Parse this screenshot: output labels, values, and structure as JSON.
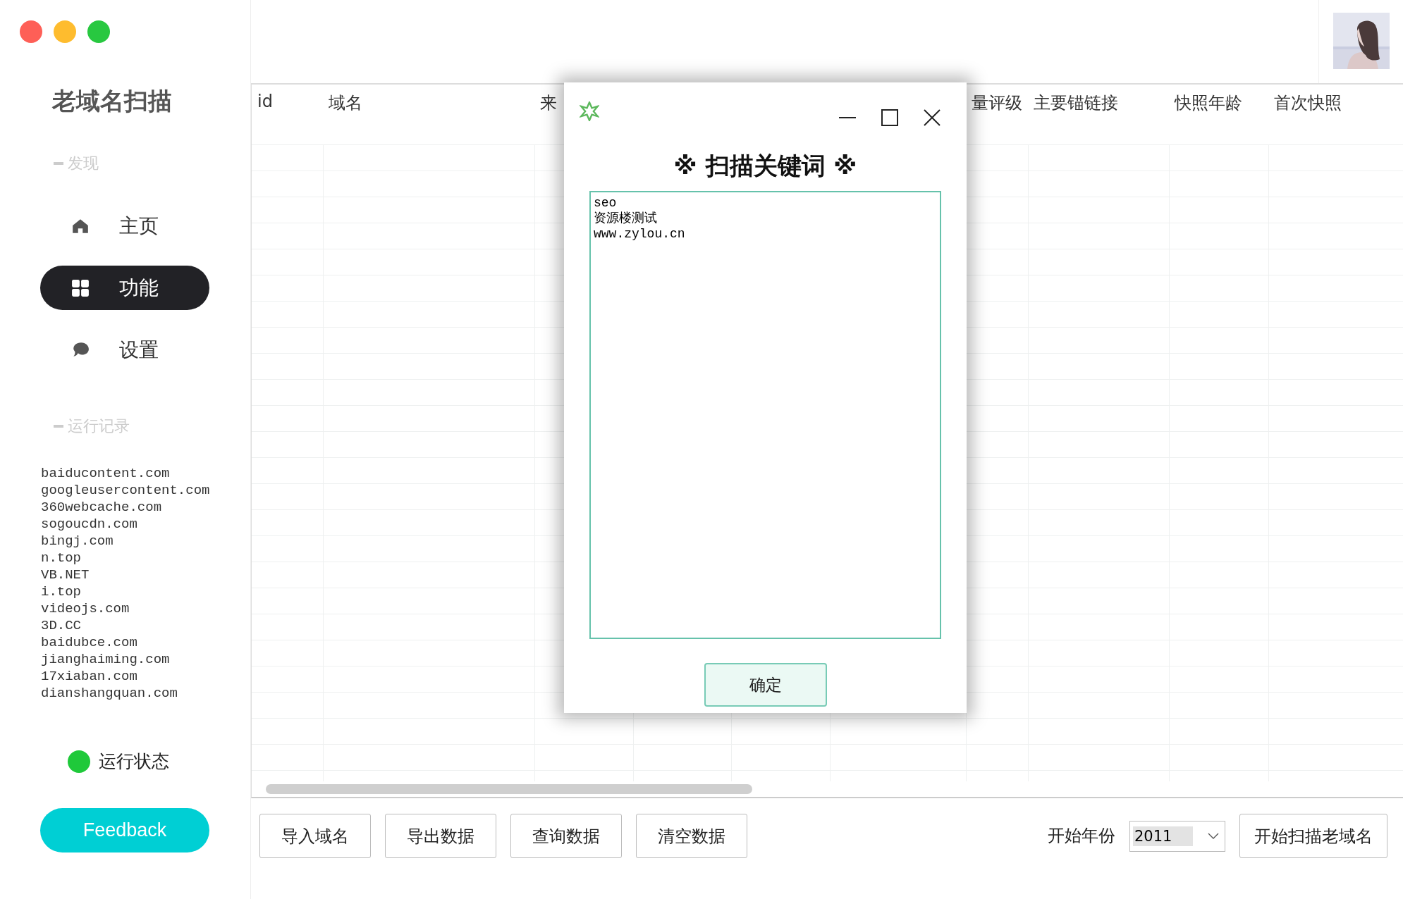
{
  "window": {
    "controls": [
      {
        "color": "#fe5f57"
      },
      {
        "color": "#febc2e"
      },
      {
        "color": "#28c840"
      }
    ]
  },
  "sidebar": {
    "title": "老域名扫描",
    "sections": [
      {
        "label": "发现"
      },
      {
        "label": "运行记录"
      }
    ],
    "nav_items": [
      {
        "label": "主页",
        "selected": false
      },
      {
        "label": "功能",
        "selected": true
      },
      {
        "label": "设置",
        "selected": false
      }
    ],
    "log": [
      "baiducontent.com",
      "googleusercontent.com",
      "360webcache.com",
      "sogoucdn.com",
      "bingj.com",
      "n.top",
      "VB.NET",
      "i.top",
      "videojs.com",
      "3D.CC",
      "baidubce.com",
      "jianghaiming.com",
      "17xiaban.com",
      "dianshangquan.com"
    ],
    "status": {
      "label": "运行状态",
      "on": true
    },
    "feedback_button": "Feedback"
  },
  "table": {
    "columns": [
      {
        "label": "id"
      },
      {
        "label": "域名"
      },
      {
        "label": "来"
      },
      {},
      {},
      {},
      {
        "label": "量评级"
      },
      {
        "label": "主要锚链接"
      },
      {
        "label": "快照年龄"
      },
      {
        "label": "首次快照"
      }
    ]
  },
  "toolbar": {
    "buttons": [
      "导入域名",
      "导出数据",
      "查询数据",
      "清空数据"
    ],
    "year_label": "开始年份",
    "year_select": {
      "value": "2011"
    },
    "start_button": "开始扫描老域名"
  },
  "dialog": {
    "title": "※ 扫描关键词 ※",
    "keywords_field": {
      "value": "seo\n资源楼测试\nwww.zylou.cn"
    },
    "ok_button": "确定"
  }
}
